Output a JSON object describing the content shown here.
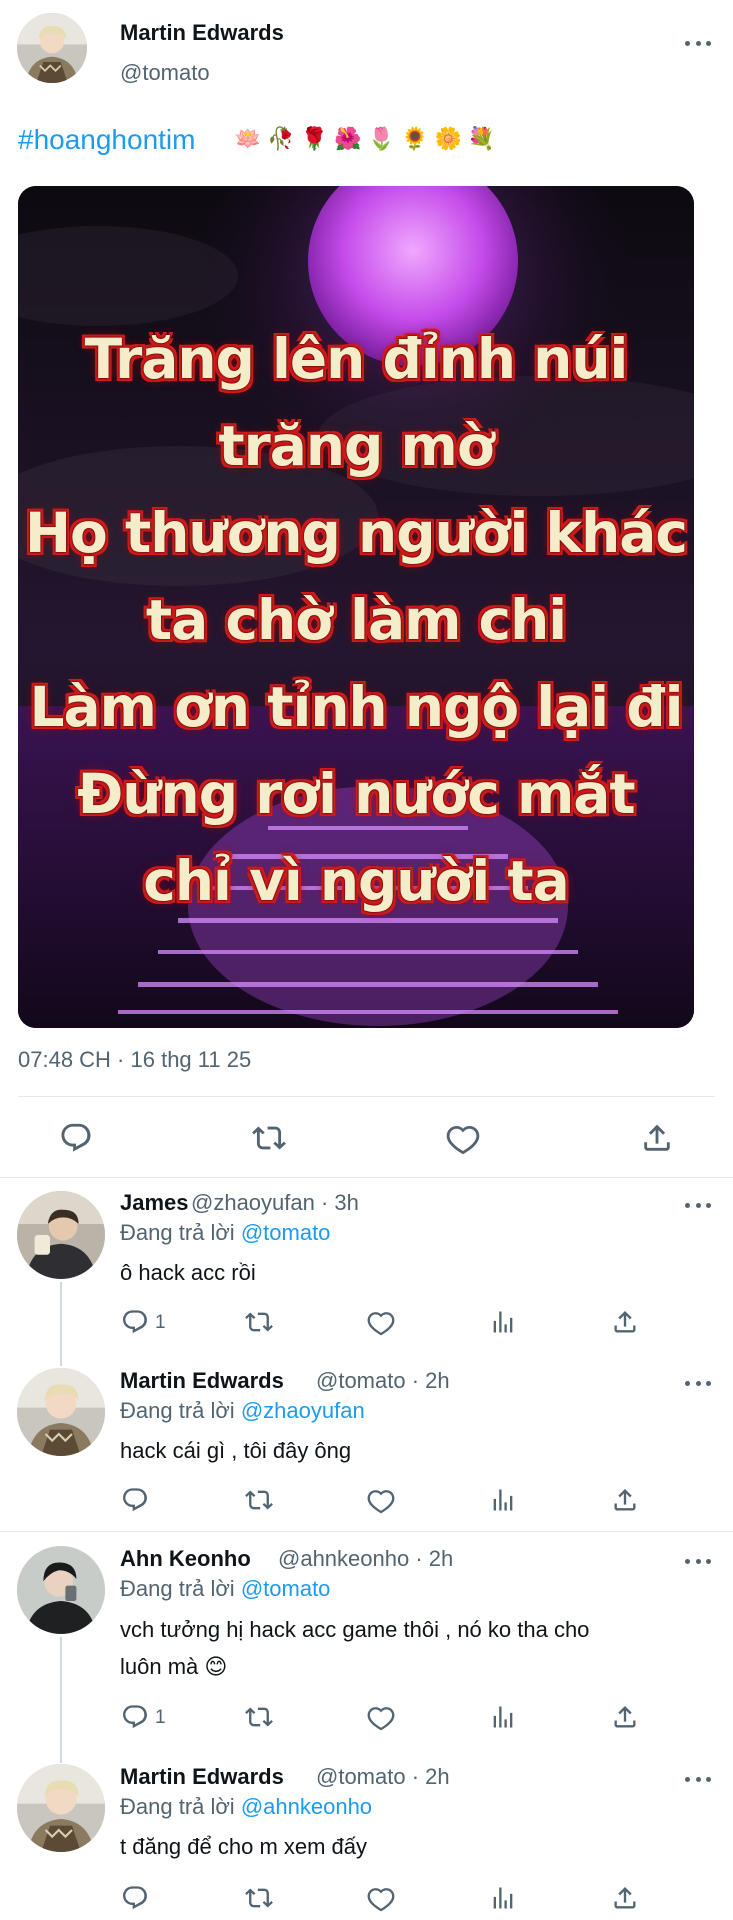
{
  "tweet": {
    "author_name": "Martin Edwards",
    "author_handle": "@tomato",
    "hashtag": "#hoanghontim",
    "emojis": [
      "🪷",
      "🥀",
      "🌹",
      "🌺",
      "🌷",
      "🌻",
      "🌼",
      "💐"
    ],
    "image_lines": [
      "Trăng lên đỉnh núi",
      "trăng mờ",
      "Họ thương người khác",
      "ta chờ làm chi",
      "Làm ơn tỉnh ngộ lại đi",
      "Đừng rơi nước mắt",
      "chỉ vì người ta"
    ],
    "timestamp": "07:48 CH · 16 thg 11 25",
    "icons": [
      "reply-icon",
      "retweet-icon",
      "like-icon",
      "share-icon"
    ]
  },
  "replies": [
    {
      "name": "James",
      "handle_time": "@zhaoyufan · 3h",
      "replying_prefix": "Đang trả lời",
      "replying_to": "@tomato",
      "text": "ô hack acc rồi",
      "reply_count": "1"
    },
    {
      "name": "Martin Edwards",
      "handle_time": "@tomato · 2h",
      "replying_prefix": "Đang trả lời",
      "replying_to": "@zhaoyufan",
      "text": "hack cái gì , tôi đây ông",
      "reply_count": ""
    },
    {
      "name": "Ahn Keonho",
      "handle_time": "@ahnkeonho · 2h",
      "replying_prefix": "Đang trả lời",
      "replying_to": "@tomato",
      "text_line1": "vch tưởng hị hack acc game thôi , nó ko tha cho",
      "text_line2": "luôn mà 😊",
      "reply_count": "1"
    },
    {
      "name": "Martin Edwards",
      "handle_time": "@tomato · 2h",
      "replying_prefix": "Đang trả lời",
      "replying_to": "@ahnkeonho",
      "text": "t đăng để cho m xem đấy",
      "reply_count": ""
    }
  ],
  "colors": {
    "link": "#1d9bf0",
    "muted": "#536471",
    "text": "#0f1419",
    "divider": "#e5e9eb"
  }
}
